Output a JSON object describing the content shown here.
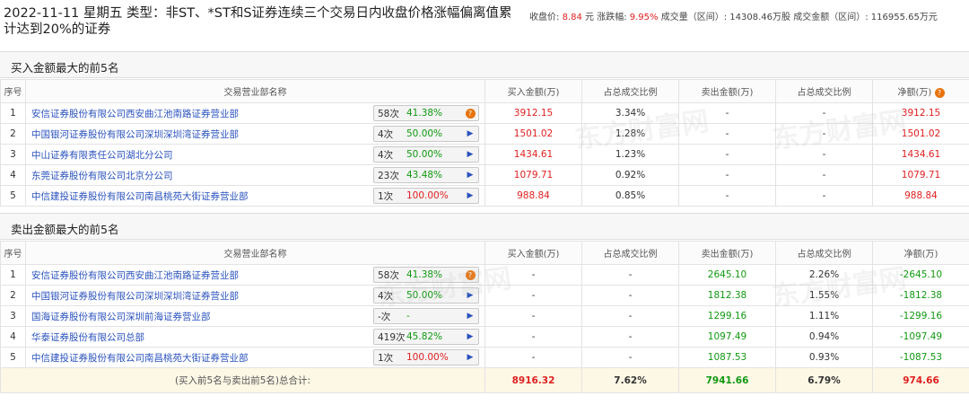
{
  "header": {
    "title": "2022-11-11 星期五 类型：非ST、*ST和S证券连续三个交易日内收盘价格涨幅偏离值累计达到20%的证券",
    "close_label": "收盘价:",
    "close_value": "8.84",
    "close_unit": "元",
    "change_label": "涨跌幅:",
    "change_value": "9.95%",
    "volume_label": "成交量（区间）:",
    "volume_value": "14308.46万股",
    "amount_label": "成交金额（区间）:",
    "amount_value": "116955.65万元"
  },
  "buy_section": {
    "title": "买入金额最大的前5名",
    "columns": [
      "序号",
      "交易营业部名称",
      "买入金额(万)",
      "占总成交比例",
      "卖出金额(万)",
      "占总成交比例",
      "净额(万)"
    ],
    "rows": [
      {
        "idx": "1",
        "name": "安信证券股份有限公司西安曲江池南路证券营业部",
        "times": "58次",
        "rate": "41.38%",
        "icon": "question-icon",
        "buy": "3912.15",
        "buy_pct": "3.34%",
        "sell": "-",
        "sell_pct": "-",
        "net": "3912.15"
      },
      {
        "idx": "2",
        "name": "中国银河证券股份有限公司深圳深圳湾证券营业部",
        "times": "4次",
        "rate": "50.00%",
        "icon": "play-icon",
        "buy": "1501.02",
        "buy_pct": "1.28%",
        "sell": "-",
        "sell_pct": "-",
        "net": "1501.02"
      },
      {
        "idx": "3",
        "name": "中山证券有限责任公司湖北分公司",
        "times": "4次",
        "rate": "50.00%",
        "icon": "play-icon",
        "buy": "1434.61",
        "buy_pct": "1.23%",
        "sell": "-",
        "sell_pct": "-",
        "net": "1434.61"
      },
      {
        "idx": "4",
        "name": "东莞证券股份有限公司北京分公司",
        "times": "23次",
        "rate": "43.48%",
        "icon": "play-icon",
        "buy": "1079.71",
        "buy_pct": "0.92%",
        "sell": "-",
        "sell_pct": "-",
        "net": "1079.71"
      },
      {
        "idx": "5",
        "name": "中信建投证券股份有限公司南昌桃苑大街证券营业部",
        "times": "1次",
        "rate": "100.00%",
        "icon": "play-icon",
        "buy": "988.84",
        "buy_pct": "0.85%",
        "sell": "-",
        "sell_pct": "-",
        "net": "988.84"
      }
    ]
  },
  "sell_section": {
    "title": "卖出金额最大的前5名",
    "columns": [
      "序号",
      "交易营业部名称",
      "买入金额(万)",
      "占总成交比例",
      "卖出金额(万)",
      "占总成交比例",
      "净额(万)"
    ],
    "rows": [
      {
        "idx": "1",
        "name": "安信证券股份有限公司西安曲江池南路证券营业部",
        "times": "58次",
        "rate": "41.38%",
        "icon": "question-icon",
        "buy": "-",
        "buy_pct": "-",
        "sell": "2645.10",
        "sell_pct": "2.26%",
        "net": "-2645.10"
      },
      {
        "idx": "2",
        "name": "中国银河证券股份有限公司深圳深圳湾证券营业部",
        "times": "4次",
        "rate": "50.00%",
        "icon": "play-icon",
        "buy": "-",
        "buy_pct": "-",
        "sell": "1812.38",
        "sell_pct": "1.55%",
        "net": "-1812.38"
      },
      {
        "idx": "3",
        "name": "国海证券股份有限公司深圳前海证券营业部",
        "times": "-次",
        "rate": "-",
        "icon": "play-icon",
        "buy": "-",
        "buy_pct": "-",
        "sell": "1299.16",
        "sell_pct": "1.11%",
        "net": "-1299.16"
      },
      {
        "idx": "4",
        "name": "华泰证券股份有限公司总部",
        "times": "419次",
        "rate": "45.82%",
        "icon": "play-icon",
        "buy": "-",
        "buy_pct": "-",
        "sell": "1097.49",
        "sell_pct": "0.94%",
        "net": "-1097.49"
      },
      {
        "idx": "5",
        "name": "中信建投证券股份有限公司南昌桃苑大街证券营业部",
        "times": "1次",
        "rate": "100.00%",
        "icon": "play-icon",
        "buy": "-",
        "buy_pct": "-",
        "sell": "1087.53",
        "sell_pct": "0.93%",
        "net": "-1087.53"
      }
    ],
    "total": {
      "label": "(买入前5名与卖出前5名)总合计:",
      "buy": "8916.32",
      "buy_pct": "7.62%",
      "sell": "7941.66",
      "sell_pct": "6.79%",
      "net": "974.66"
    }
  },
  "watermark": "东方财富网",
  "colors": {
    "red": "#e02020",
    "green": "#119911",
    "link": "#2a52be"
  }
}
